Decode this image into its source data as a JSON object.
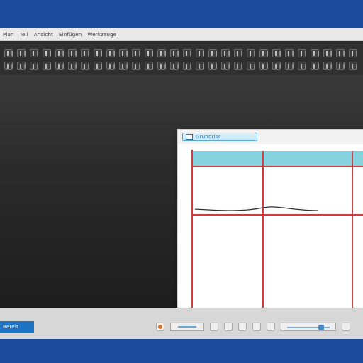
{
  "menu": {
    "items": [
      {
        "label": "Plan"
      },
      {
        "label": "Teil"
      },
      {
        "label": "Ansicht"
      },
      {
        "label": "Einfügen"
      },
      {
        "label": "Werkzeuge"
      }
    ]
  },
  "document": {
    "tab_label": "Grundriss"
  },
  "status": {
    "left_label": "Bereit"
  },
  "colors": {
    "grid_red": "#d23b3b",
    "header_teal": "#86d3df",
    "accent_blue": "#1f73c4"
  }
}
